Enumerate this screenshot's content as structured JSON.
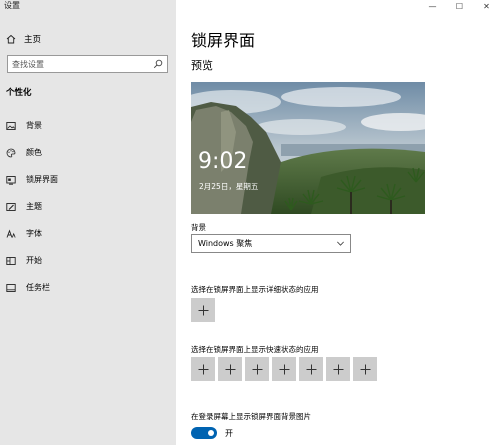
{
  "window": {
    "title": "设置",
    "controls": {
      "minimize": "—",
      "maximize": "☐",
      "close": "✕"
    }
  },
  "sidebar": {
    "home_label": "主页",
    "search_placeholder": "查找设置",
    "section_title": "个性化",
    "items": [
      {
        "label": "背景",
        "icon": "picture-icon"
      },
      {
        "label": "颜色",
        "icon": "palette-icon"
      },
      {
        "label": "锁屏界面",
        "icon": "lock-screen-icon",
        "selected": true
      },
      {
        "label": "主题",
        "icon": "brush-icon"
      },
      {
        "label": "字体",
        "icon": "font-icon"
      },
      {
        "label": "开始",
        "icon": "start-icon"
      },
      {
        "label": "任务栏",
        "icon": "taskbar-icon"
      }
    ]
  },
  "main": {
    "page_title": "锁屏界面",
    "preview_label": "预览",
    "lock_time": "9:02",
    "lock_date": "2月25日，星期五",
    "background_label": "背景",
    "background_value": "Windows 聚焦",
    "detail_status_label": "选择在锁屏界面上显示详细状态的应用",
    "detail_status_apps": 1,
    "quick_status_label": "选择在锁屏界面上显示快速状态的应用",
    "quick_status_apps": 7,
    "signin_label": "在登录屏幕上显示锁屏界面背景图片",
    "signin_toggle": {
      "state": "on",
      "label": "开"
    }
  },
  "colors": {
    "sidebar_bg": "#e6e6e6",
    "accent": "#0063b1",
    "button_bg": "#cccccc"
  }
}
